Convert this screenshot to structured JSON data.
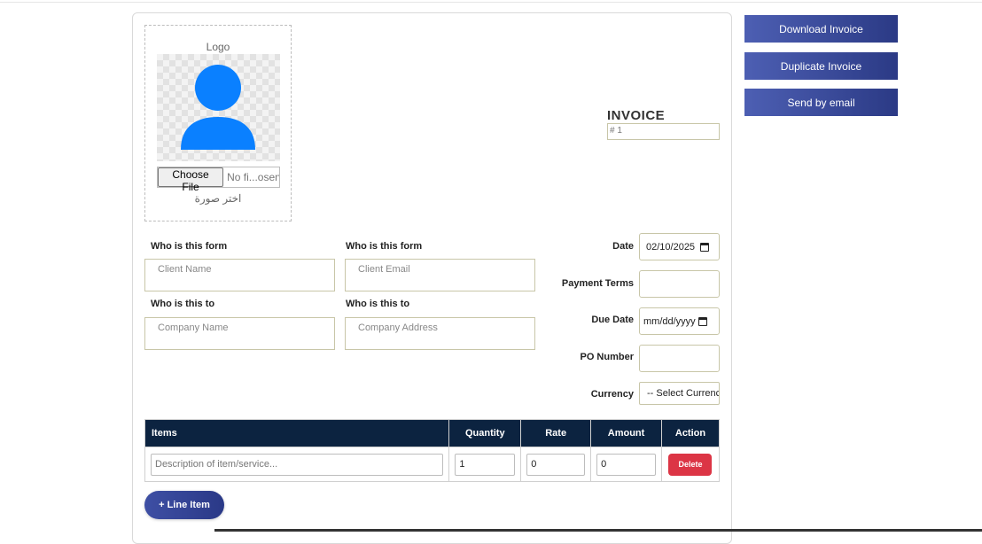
{
  "logo": {
    "label": "Logo",
    "file_button": "Choose File",
    "file_status": "No fi...osen",
    "caption": "اختر صورة"
  },
  "invoice": {
    "title": "INVOICE",
    "number_placeholder": "# 1"
  },
  "from": {
    "label_1": "Who is this form",
    "label_2": "Who is this form",
    "client_name_placeholder": "Client Name",
    "client_email_placeholder": "Client Email"
  },
  "to": {
    "label_1": "Who is this to",
    "label_2": "Who is this to",
    "company_name_placeholder": "Company Name",
    "company_address_placeholder": "Company Address"
  },
  "meta": {
    "date_label": "Date",
    "date_value": "02/10/2025",
    "payment_terms_label": "Payment Terms",
    "due_date_label": "Due Date",
    "due_date_value": "mm/dd/yyyy",
    "po_number_label": "PO Number",
    "currency_label": "Currency",
    "currency_value": "-- Select Currency --"
  },
  "table": {
    "headers": [
      "Items",
      "Quantity",
      "Rate",
      "Amount",
      "Action"
    ],
    "rows": [
      {
        "description_placeholder": "Description of item/service...",
        "quantity": "1",
        "rate": "0",
        "amount": "0",
        "action": "Delete"
      }
    ]
  },
  "add_line_item": "+ Line Item",
  "side_actions": {
    "download": "Download Invoice",
    "duplicate": "Duplicate Invoice",
    "email": "Send by email"
  },
  "colors": {
    "table_header": "#0c2340",
    "delete": "#dc3545",
    "accent": "#3e4fa4",
    "avatar": "#0a80ff"
  }
}
